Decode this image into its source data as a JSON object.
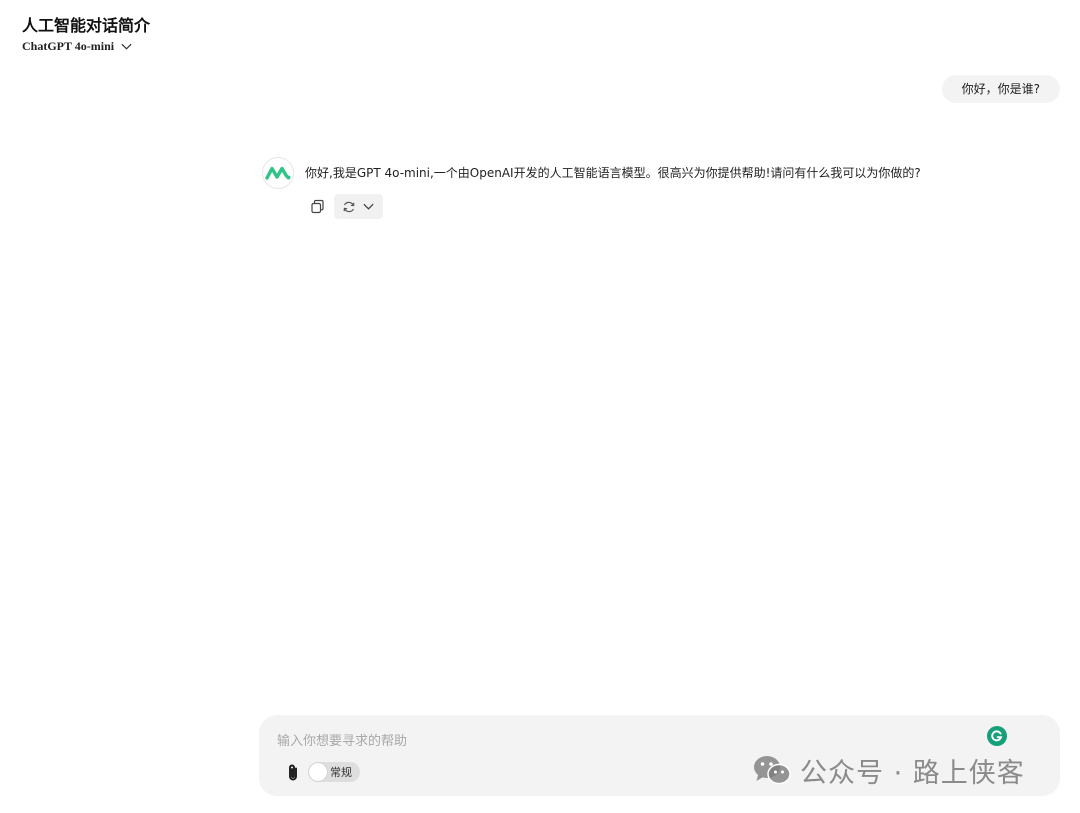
{
  "header": {
    "title": "人工智能对话简介",
    "model": "ChatGPT 4o-mini"
  },
  "conversation": {
    "user_message": "你好，你是谁?",
    "assistant_message": "你好,我是GPT 4o-mini,一个由OpenAI开发的人工智能语言模型。很高兴为你提供帮助!请问有什么我可以为你做的?"
  },
  "composer": {
    "placeholder": "输入你想要寻求的帮助",
    "value": "",
    "mode_label": "常规"
  },
  "watermark": {
    "text": "公众号 · 路上侠客"
  },
  "colors": {
    "brand_green": "#2ec486",
    "grammarly_green": "#16a07a",
    "bubble_bg": "#f3f3f3"
  },
  "icons": [
    "chevron-down-icon",
    "brand-logo-icon",
    "copy-icon",
    "refresh-icon",
    "paperclip-icon",
    "grammarly-icon",
    "wechat-icon"
  ]
}
